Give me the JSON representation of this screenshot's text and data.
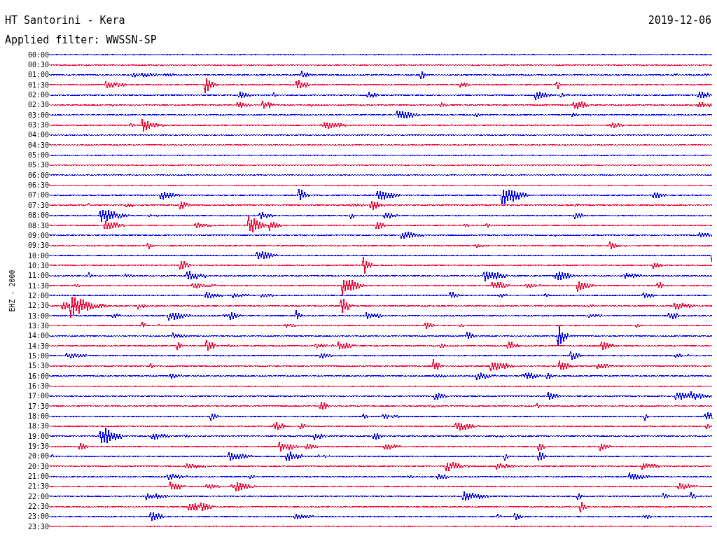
{
  "header": {
    "title": "HT Santorini - Kera",
    "date": "2019-12-06",
    "filter": "Applied filter: WWSSN-SP"
  },
  "axis_label": "EHZ - 2000",
  "traces": [
    {
      "time": "00:00",
      "color": "#0000ff"
    },
    {
      "time": "00:30",
      "color": "#ff0033"
    },
    {
      "time": "01:00",
      "color": "#0000ff"
    },
    {
      "time": "01:30",
      "color": "#ff0033"
    },
    {
      "time": "02:00",
      "color": "#0000ff"
    },
    {
      "time": "02:30",
      "color": "#ff0033"
    },
    {
      "time": "03:00",
      "color": "#0000ff"
    },
    {
      "time": "03:30",
      "color": "#ff0033"
    },
    {
      "time": "04:00",
      "color": "#0000ff"
    },
    {
      "time": "04:30",
      "color": "#ff0033"
    },
    {
      "time": "05:00",
      "color": "#0000ff"
    },
    {
      "time": "05:30",
      "color": "#ff0033"
    },
    {
      "time": "06:00",
      "color": "#0000ff"
    },
    {
      "time": "06:30",
      "color": "#ff0033"
    },
    {
      "time": "07:00",
      "color": "#0000ff"
    },
    {
      "time": "07:30",
      "color": "#ff0033"
    },
    {
      "time": "08:00",
      "color": "#0000ff"
    },
    {
      "time": "08:30",
      "color": "#ff0033"
    },
    {
      "time": "09:00",
      "color": "#0000ff"
    },
    {
      "time": "09:30",
      "color": "#ff0033"
    },
    {
      "time": "10:00",
      "color": "#0000ff"
    },
    {
      "time": "10:30",
      "color": "#ff0033"
    },
    {
      "time": "11:00",
      "color": "#0000ff"
    },
    {
      "time": "11:30",
      "color": "#ff0033"
    },
    {
      "time": "12:00",
      "color": "#0000ff"
    },
    {
      "time": "12:30",
      "color": "#ff0033"
    },
    {
      "time": "13:00",
      "color": "#0000ff"
    },
    {
      "time": "13:30",
      "color": "#ff0033"
    },
    {
      "time": "14:00",
      "color": "#0000ff"
    },
    {
      "time": "14:30",
      "color": "#ff0033"
    },
    {
      "time": "15:00",
      "color": "#0000ff"
    },
    {
      "time": "15:30",
      "color": "#ff0033"
    },
    {
      "time": "16:00",
      "color": "#0000ff"
    },
    {
      "time": "16:30",
      "color": "#ff0033"
    },
    {
      "time": "17:00",
      "color": "#0000ff"
    },
    {
      "time": "17:30",
      "color": "#ff0033"
    },
    {
      "time": "18:00",
      "color": "#0000ff"
    },
    {
      "time": "18:30",
      "color": "#ff0033"
    },
    {
      "time": "19:00",
      "color": "#0000ff"
    },
    {
      "time": "19:30",
      "color": "#ff0033"
    },
    {
      "time": "20:00",
      "color": "#0000ff"
    },
    {
      "time": "20:30",
      "color": "#ff0033"
    },
    {
      "time": "21:00",
      "color": "#0000ff"
    },
    {
      "time": "21:30",
      "color": "#ff0033"
    },
    {
      "time": "22:00",
      "color": "#0000ff"
    },
    {
      "time": "22:30",
      "color": "#ff0033"
    },
    {
      "time": "23:00",
      "color": "#0000ff"
    },
    {
      "time": "23:30",
      "color": "#ff0033"
    }
  ]
}
